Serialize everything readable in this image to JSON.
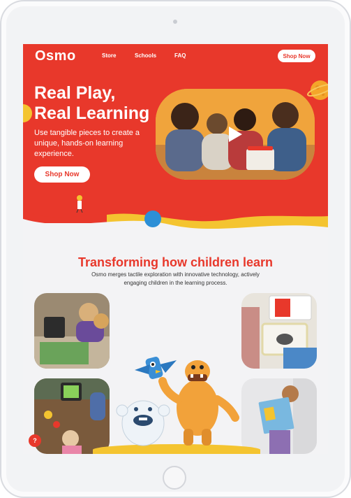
{
  "nav": {
    "logo": "Osmo",
    "links": [
      "Store",
      "Schools",
      "FAQ"
    ],
    "cta": "Shop Now"
  },
  "hero": {
    "title_line1": "Real Play,",
    "title_line2": "Real Learning",
    "subtitle": "Use tangible pieces to create a unique, hands-on learning experience.",
    "cta": "Shop Now"
  },
  "section": {
    "title": "Transforming how children learn",
    "text": "Osmo merges tactile exploration with innovative technology, actively engaging children in the learning process."
  },
  "help_icon": "?",
  "colors": {
    "brand": "#e8382b",
    "accent_yellow": "#f4c430",
    "background": "#f3f3f5"
  },
  "icons": [
    "play-icon",
    "help-icon",
    "home-button",
    "camera"
  ]
}
